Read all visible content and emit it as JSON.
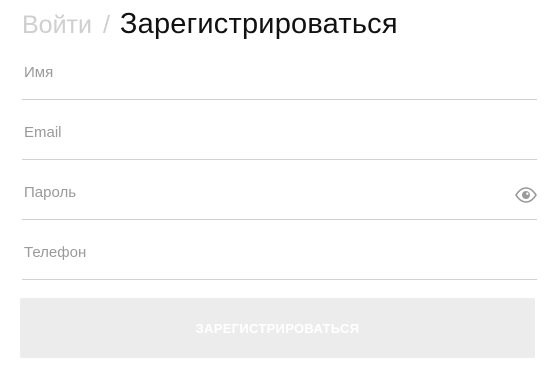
{
  "tabs": {
    "login_label": "Войти",
    "separator": "/",
    "register_label": "Зарегистрироваться"
  },
  "fields": {
    "name": {
      "placeholder": "Имя",
      "value": ""
    },
    "email": {
      "placeholder": "Email",
      "value": ""
    },
    "password": {
      "placeholder": "Пароль",
      "value": ""
    },
    "phone": {
      "placeholder": "Телефон",
      "value": ""
    }
  },
  "icons": {
    "password_toggle": "eye-icon"
  },
  "submit": {
    "label": "ЗАРЕГИСТРИРОВАТЬСЯ"
  },
  "colors": {
    "active_tab": "#111111",
    "inactive_tab": "#cfcfcf",
    "placeholder": "#9a9a9a",
    "divider": "#d2d2d2",
    "button_bg": "#ececec",
    "button_text": "#ffffff"
  }
}
